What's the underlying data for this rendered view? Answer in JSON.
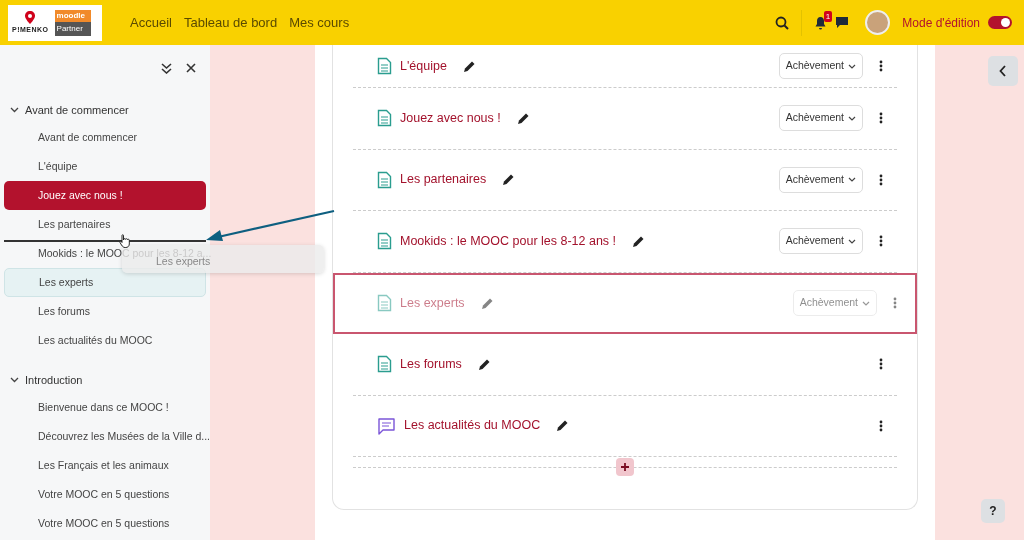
{
  "header": {
    "logo": {
      "brand": "P!MENKO",
      "badge_top": "moodle",
      "badge_bottom": "Partner"
    },
    "nav": [
      {
        "label": "Accueil"
      },
      {
        "label": "Tableau de bord"
      },
      {
        "label": "Mes cours"
      }
    ],
    "notifications": {
      "count": "1"
    },
    "edit_mode": {
      "label": "Mode d'édition",
      "on": true
    }
  },
  "sidebar": {
    "sections": [
      {
        "title": "Avant de commencer",
        "expanded": true,
        "items": [
          {
            "label": "Avant de commencer",
            "selected": false,
            "dragging": false,
            "drop_target": false
          },
          {
            "label": "L'équipe",
            "selected": false,
            "dragging": false,
            "drop_target": false
          },
          {
            "label": "Jouez avec nous !",
            "selected": true,
            "dragging": false,
            "drop_target": false
          },
          {
            "label": "Les partenaires",
            "selected": false,
            "dragging": false,
            "drop_target": true
          },
          {
            "label": "Mookids : le MOOC pour les 8-12 a...",
            "selected": false,
            "dragging": false,
            "drop_target": false
          },
          {
            "label": "Les experts",
            "selected": false,
            "dragging": true,
            "drop_target": false
          },
          {
            "label": "Les forums",
            "selected": false,
            "dragging": false,
            "drop_target": false
          },
          {
            "label": "Les actualités du MOOC",
            "selected": false,
            "dragging": false,
            "drop_target": false
          }
        ]
      },
      {
        "title": "Introduction",
        "expanded": true,
        "items": [
          {
            "label": "Bienvenue dans ce MOOC !",
            "selected": false,
            "dragging": false,
            "drop_target": false
          },
          {
            "label": "Découvrez les Musées de la Ville d...",
            "selected": false,
            "dragging": false,
            "drop_target": false
          },
          {
            "label": "Les Français et les animaux",
            "selected": false,
            "dragging": false,
            "drop_target": false
          },
          {
            "label": "Votre MOOC en 5 questions",
            "selected": false,
            "dragging": false,
            "drop_target": false
          },
          {
            "label": "Votre MOOC en 5 questions",
            "selected": false,
            "dragging": false,
            "drop_target": false
          }
        ]
      }
    ],
    "drag_ghost": {
      "label": "Les experts"
    }
  },
  "activities": [
    {
      "kind": "page",
      "name": "L'équipe",
      "completion": "Achèvement",
      "dragging": false
    },
    {
      "kind": "page",
      "name": "Jouez avec nous !",
      "completion": "Achèvement",
      "dragging": false
    },
    {
      "kind": "page",
      "name": "Les partenaires",
      "completion": "Achèvement",
      "dragging": false
    },
    {
      "kind": "page",
      "name": "Mookids : le MOOC pour les 8-12 ans !",
      "completion": "Achèvement",
      "dragging": false
    },
    {
      "kind": "page",
      "name": "Les experts",
      "completion": "Achèvement",
      "dragging": true
    },
    {
      "kind": "page",
      "name": "Les forums",
      "dragging": false
    },
    {
      "kind": "forum",
      "name": "Les actualités du MOOC",
      "dragging": false
    }
  ],
  "help_button": {
    "label": "?"
  }
}
